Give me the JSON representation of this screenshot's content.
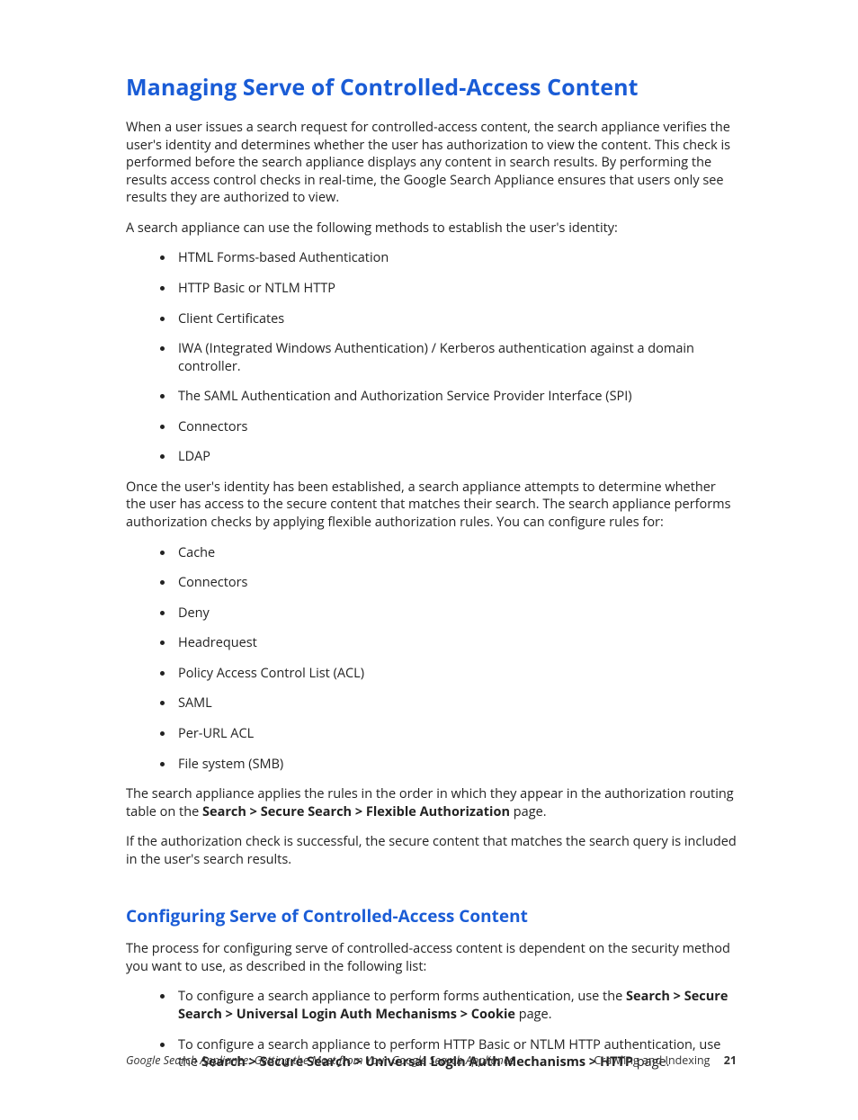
{
  "h1": "Managing Serve of Controlled-Access Content",
  "p1": "When a user issues a search request for controlled-access content, the search appliance verifies the user's identity and determines whether the user has authorization to view the content. This check is performed before the search appliance displays any content in search results. By performing the results access control checks in real-time, the Google Search Appliance ensures that users only see results they are authorized to view.",
  "p2": "A search appliance can use the following methods to establish the user's identity:",
  "list1": [
    "HTML Forms-based Authentication",
    "HTTP Basic or NTLM HTTP",
    "Client Certificates",
    "IWA (Integrated Windows Authentication) / Kerberos authentication against a domain controller.",
    "The SAML Authentication and Authorization Service Provider Interface (SPI)",
    "Connectors",
    "LDAP"
  ],
  "p3": "Once the user's identity has been established, a search appliance attempts to determine whether the user has access to the secure content that matches their search. The search appliance performs authorization checks by applying flexible authorization rules. You can configure rules for:",
  "list2": [
    "Cache",
    "Connectors",
    "Deny",
    "Headrequest",
    "Policy Access Control List (ACL)",
    "SAML",
    "Per-URL ACL",
    "File system (SMB)"
  ],
  "p4_a": "The search appliance applies the rules in the order in which they appear in the authorization routing table on the ",
  "p4_b": "Search > Secure Search > Flexible Authorization",
  "p4_c": " page.",
  "p5": "If the authorization check is successful, the secure content that matches the search query is included in the user's search results.",
  "h2": "Configuring Serve of Controlled-Access Content",
  "p6": "The process for configuring serve of controlled-access content is dependent on the security method you want to use, as described in the following list:",
  "li3a_1": "To configure a search appliance to perform forms authentication, use the ",
  "li3a_2": "Search > Secure Search > Universal Login Auth Mechanisms > Cookie",
  "li3a_3": " page.",
  "li3b_1": "To configure a search appliance to perform HTTP Basic or NTLM HTTP authentication, use the ",
  "li3b_2": "Search > Secure Search > Universal Login Auth Mechanisms > HTTP",
  "li3b_3": " page.",
  "footer_left": "Google Search Appliance: Getting the Most from Your Google Search Appliance",
  "footer_right": "Crawling and Indexing",
  "page_num": "21"
}
